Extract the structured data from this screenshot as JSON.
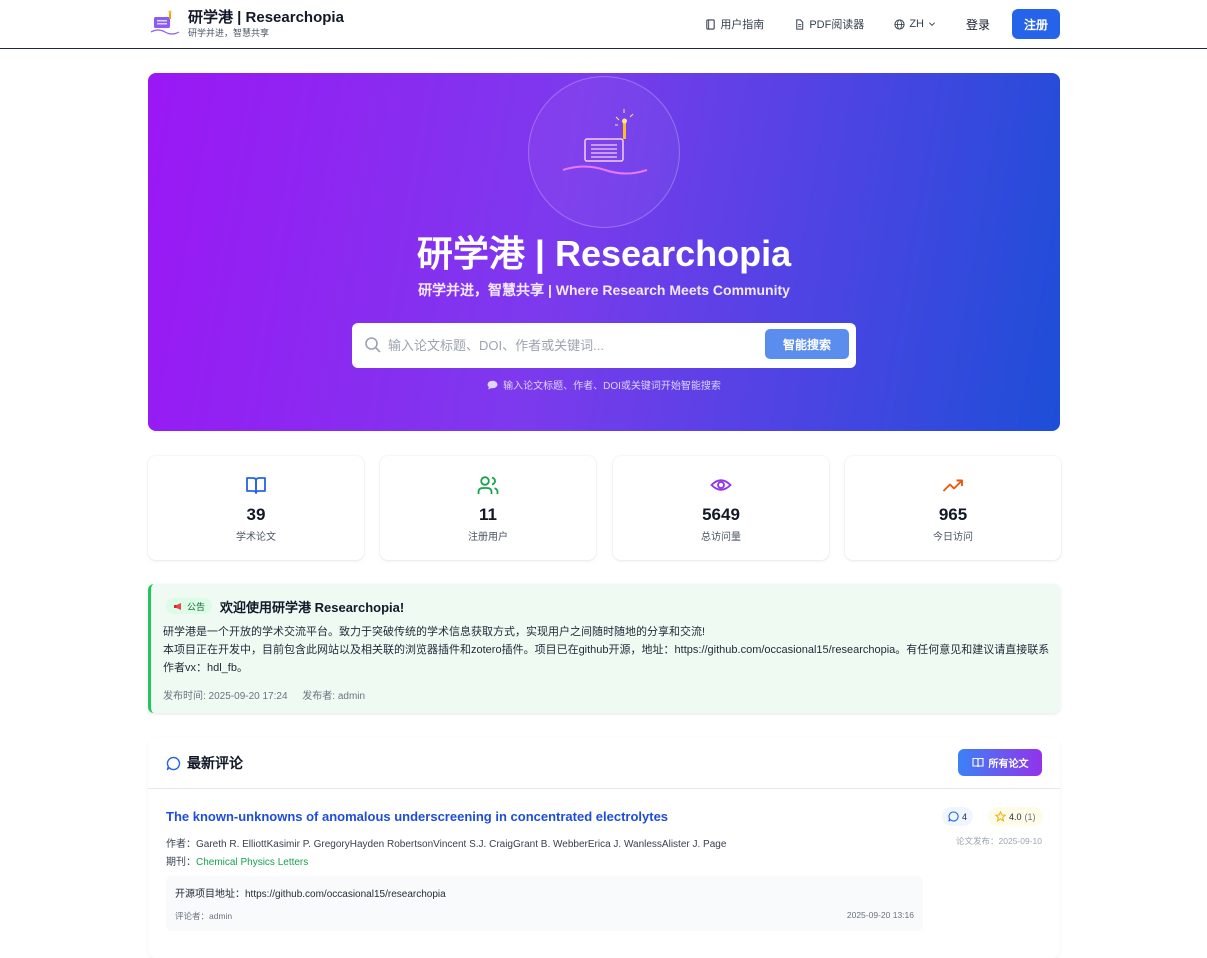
{
  "header": {
    "brand_title": "研学港 | Researchopia",
    "brand_sub": "研学并进，智慧共享",
    "nav": {
      "guide": "用户指南",
      "pdf_reader": "PDF阅读器",
      "lang": "ZH",
      "login": "登录",
      "register": "注册"
    }
  },
  "hero": {
    "title": "研学港 | Researchopia",
    "subtitle": "研学并进，智慧共享 | Where Research Meets Community",
    "search_placeholder": "输入论文标题、DOI、作者或关键词...",
    "search_button": "智能搜索",
    "hint": "输入论文标题、作者、DOI或关键词开始智能搜索"
  },
  "stats": [
    {
      "value": "39",
      "label": "学术论文",
      "icon": "book-open-icon",
      "color": "#2563eb"
    },
    {
      "value": "11",
      "label": "注册用户",
      "icon": "users-icon",
      "color": "#16a34a"
    },
    {
      "value": "5649",
      "label": "总访问量",
      "icon": "eye-icon",
      "color": "#9333ea"
    },
    {
      "value": "965",
      "label": "今日访问",
      "icon": "trending-up-icon",
      "color": "#ea580c"
    }
  ],
  "announcement": {
    "badge": "公告",
    "title": "欢迎使用研学港 Researchopia!",
    "line1": "研学港是一个开放的学术交流平台。致力于突破传统的学术信息获取方式，实现用户之间随时随地的分享和交流!",
    "line2": "本项目正在开发中，目前包含此网站以及相关联的浏览器插件和zotero插件。项目已在github开源，地址：https://github.com/occasional15/researchopia。有任何意见和建议请直接联系作者vx：hdl_fb。",
    "published": "发布时间: 2025-09-20 17:24",
    "publisher": "发布者: admin"
  },
  "comments": {
    "title": "最新评论",
    "all_papers": "所有论文",
    "item": {
      "paper_title": "The known-unknowns of anomalous underscreening in concentrated electrolytes",
      "authors_label": "作者：",
      "authors": "Gareth R. ElliottKasimir P. GregoryHayden RobertsonVincent S.J. CraigGrant B. WebberErica J. WanlessAlister J. Page",
      "journal_label": "期刊：",
      "journal": "Chemical Physics Letters",
      "comment_count": "4",
      "rating": "4.0",
      "rating_count": "(1)",
      "published_date": "论文发布：2025-09-10",
      "comment_text": "开源项目地址：https://github.com/occasional15/researchopia",
      "commenter": "评论者：admin",
      "comment_time": "2025-09-20 13:16"
    }
  }
}
